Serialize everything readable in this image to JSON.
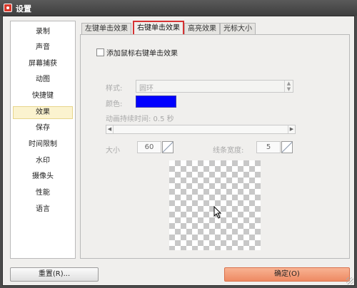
{
  "window": {
    "title": "设置"
  },
  "sidebar": {
    "items": [
      {
        "label": "录制"
      },
      {
        "label": "声音"
      },
      {
        "label": "屏幕捕获"
      },
      {
        "label": "动图"
      },
      {
        "label": "快捷键"
      },
      {
        "label": "效果",
        "active": true
      },
      {
        "label": "保存"
      },
      {
        "label": "时间限制"
      },
      {
        "label": "水印"
      },
      {
        "label": "摄像头"
      },
      {
        "label": "性能"
      },
      {
        "label": "语言"
      }
    ]
  },
  "tabs": [
    {
      "label": "左键单击效果"
    },
    {
      "label": "右键单击效果",
      "active": true
    },
    {
      "label": "高亮效果"
    },
    {
      "label": "光标大小"
    }
  ],
  "panel": {
    "enable_label": "添加鼠标右键单击效果",
    "enable_checked": false,
    "style_label": "样式:",
    "style_value": "圆环",
    "color_label": "颜色:",
    "color_value": "#0000ff",
    "duration_label": "动画持续时间: 0.5 秒",
    "duration_fraction": 0.0,
    "size_label": "大小",
    "size_value": "60",
    "line_width_label": "线条宽度:",
    "line_width_value": "5"
  },
  "footer": {
    "reset_label": "重置(R)...",
    "ok_label": "确定(O)"
  },
  "colors": {
    "highlight_box": "#d63333",
    "ok_button": "#ee8a63",
    "active_nav": "#fbf3cf"
  }
}
